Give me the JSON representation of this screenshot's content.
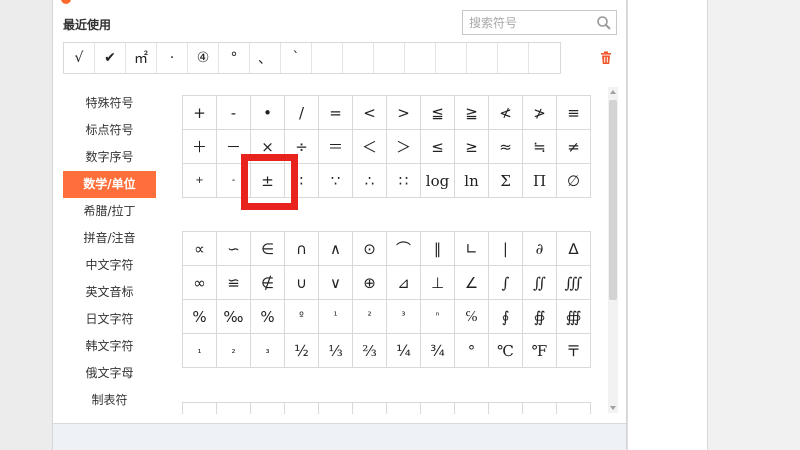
{
  "recent": {
    "title": "最近使用",
    "items": [
      "√",
      "✔",
      "㎡",
      "·",
      "④",
      "°",
      "、",
      "ˋ",
      "",
      "",
      "",
      "",
      "",
      "",
      "",
      ""
    ]
  },
  "search": {
    "placeholder": "搜索符号"
  },
  "categories": [
    {
      "label": "特殊符号"
    },
    {
      "label": "标点符号"
    },
    {
      "label": "数字序号"
    },
    {
      "label": "数学/单位",
      "active": true
    },
    {
      "label": "希腊/拉丁"
    },
    {
      "label": "拼音/注音"
    },
    {
      "label": "中文字符"
    },
    {
      "label": "英文音标"
    },
    {
      "label": "日文字符"
    },
    {
      "label": "韩文字符"
    },
    {
      "label": "俄文字母"
    },
    {
      "label": "制表符"
    }
  ],
  "grid1": [
    "+",
    "-",
    "•",
    "/",
    "=",
    "<",
    ">",
    "≦",
    "≧",
    "≮",
    "≯",
    "≡",
    "＋",
    "－",
    "×",
    "÷",
    "＝",
    "＜",
    "＞",
    "≤",
    "≥",
    "≈",
    "≒",
    "≠",
    "+",
    "-",
    "±",
    "∶",
    "∵",
    "∴",
    "∷",
    "log",
    "ln",
    "Σ",
    "Π",
    "∅"
  ],
  "grid2": [
    "∝",
    "∽",
    "∈",
    "∩",
    "∧",
    "⊙",
    "⌒",
    "∥",
    "∟",
    "∣",
    "∂",
    "∆",
    "∞",
    "≌",
    "∉",
    "∪",
    "∨",
    "⊕",
    "⊿",
    "⊥",
    "∠",
    "∫",
    "∬",
    "∭",
    "%",
    "‰",
    "%",
    "º",
    "¹",
    "²",
    "³",
    "ⁿ",
    "℅",
    "∮",
    "∯",
    "∰",
    "₁",
    "₂",
    "₃",
    "½",
    "⅓",
    "⅔",
    "¼",
    "¾",
    "°",
    "℃",
    "℉",
    "〒"
  ],
  "grid3": [
    "",
    "",
    "",
    "",
    "",
    "",
    "",
    "",
    "",
    "",
    "",
    ""
  ],
  "colors": {
    "accent": "#ff6f3c",
    "highlight": "#e8231e",
    "trash": "#f0562a"
  }
}
